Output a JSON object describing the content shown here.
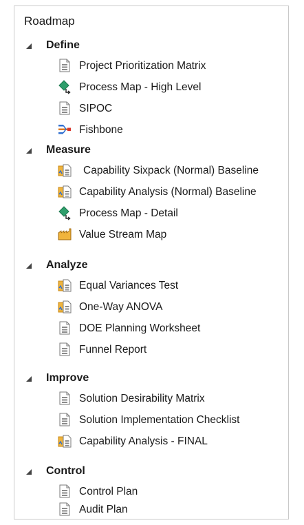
{
  "roadmap": {
    "title": "Roadmap",
    "phases": [
      {
        "label": "Define",
        "items": [
          {
            "label": "Project Prioritization Matrix",
            "icon": "form-icon"
          },
          {
            "label": "Process Map - High Level",
            "icon": "process-map-icon"
          },
          {
            "label": "SIPOC",
            "icon": "form-icon"
          },
          {
            "label": "Fishbone",
            "icon": "fishbone-icon"
          }
        ]
      },
      {
        "label": "Measure",
        "items": [
          {
            "label": "Capability Sixpack (Normal) Baseline",
            "icon": "analysis-icon"
          },
          {
            "label": "Capability Analysis (Normal) Baseline",
            "icon": "analysis-icon"
          },
          {
            "label": "Process Map - Detail",
            "icon": "process-map-icon"
          },
          {
            "label": "Value Stream Map",
            "icon": "value-stream-icon"
          }
        ]
      },
      {
        "label": "Analyze",
        "items": [
          {
            "label": "Equal Variances Test",
            "icon": "analysis-icon"
          },
          {
            "label": "One-Way ANOVA",
            "icon": "analysis-icon"
          },
          {
            "label": "DOE Planning Worksheet",
            "icon": "form-icon"
          },
          {
            "label": "Funnel Report",
            "icon": "form-icon"
          }
        ]
      },
      {
        "label": "Improve",
        "items": [
          {
            "label": "Solution Desirability Matrix",
            "icon": "form-icon"
          },
          {
            "label": "Solution Implementation Checklist",
            "icon": "form-icon"
          },
          {
            "label": "Capability Analysis - FINAL",
            "icon": "analysis-icon"
          }
        ]
      },
      {
        "label": "Control",
        "items": [
          {
            "label": "Control Plan",
            "icon": "form-icon"
          },
          {
            "label": "Audit Plan",
            "icon": "form-icon"
          }
        ]
      }
    ]
  }
}
